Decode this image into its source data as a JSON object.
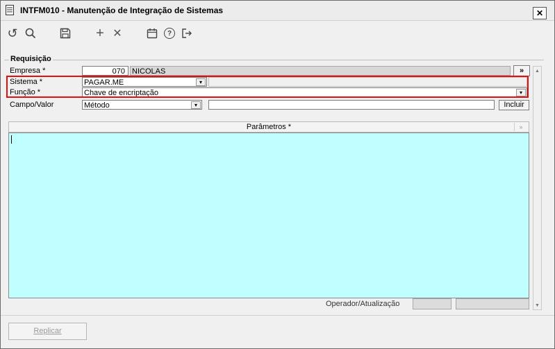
{
  "window": {
    "title": "INTFM010 - Manutenção de Integração de Sistemas",
    "close_label": "✕"
  },
  "toolbar": {
    "refresh_icon": "↺",
    "search_icon": "search-icon",
    "save_icon": "save-icon",
    "add_icon": "+",
    "delete_icon": "✕",
    "calendar_icon": "calendar-icon",
    "help_icon": "?",
    "exit_icon": "exit-icon"
  },
  "form": {
    "group_title": "Requisição",
    "empresa": {
      "label": "Empresa *",
      "code": "070",
      "name": "NICOLAS",
      "expand_label": "»"
    },
    "sistema": {
      "label": "Sistema *",
      "value": "PAGAR.ME"
    },
    "funcao": {
      "label": "Função *",
      "value": "Chave de encriptação"
    },
    "campo_valor": {
      "label": "Campo/Valor",
      "value": "Método",
      "text": "",
      "incluir_label": "Incluir"
    },
    "parametros_header": "Parâmetros *",
    "parametros_value": "",
    "operador_label": "Operador/Atualização",
    "operador_value": "",
    "atualizacao_value": ""
  },
  "footer": {
    "replicar_label": "Replicar"
  },
  "colors": {
    "accent_red": "#e01010",
    "params_bg": "#c0ffff",
    "window_bg": "#f0f0f0"
  }
}
